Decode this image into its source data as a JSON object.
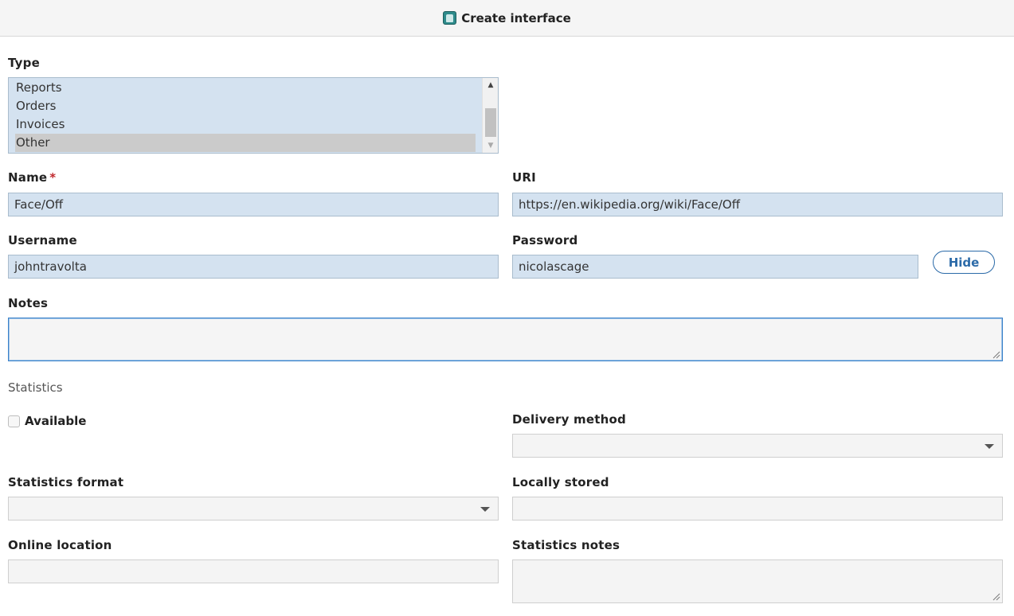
{
  "header": {
    "title": "Create interface",
    "icon": "database-icon"
  },
  "type": {
    "label": "Type",
    "options": [
      "Reports",
      "Orders",
      "Invoices",
      "Other"
    ],
    "selected": "Other"
  },
  "name": {
    "label": "Name",
    "required_mark": "*",
    "value": "Face/Off"
  },
  "uri": {
    "label": "URI",
    "value": "https://en.wikipedia.org/wiki/Face/Off"
  },
  "username": {
    "label": "Username",
    "value": "johntravolta"
  },
  "password": {
    "label": "Password",
    "value": "nicolascage",
    "hide_label": "Hide"
  },
  "notes": {
    "label": "Notes",
    "value": ""
  },
  "statistics": {
    "section_label": "Statistics",
    "available_label": "Available",
    "available_checked": false,
    "delivery_method_label": "Delivery method",
    "delivery_method_value": "",
    "statistics_format_label": "Statistics format",
    "statistics_format_value": "",
    "locally_stored_label": "Locally stored",
    "locally_stored_value": "",
    "online_location_label": "Online location",
    "online_location_value": "",
    "statistics_notes_label": "Statistics notes",
    "statistics_notes_value": ""
  },
  "colors": {
    "field_bg": "#d4e2f0",
    "accent": "#2b6aa8",
    "required": "#c0282d"
  }
}
